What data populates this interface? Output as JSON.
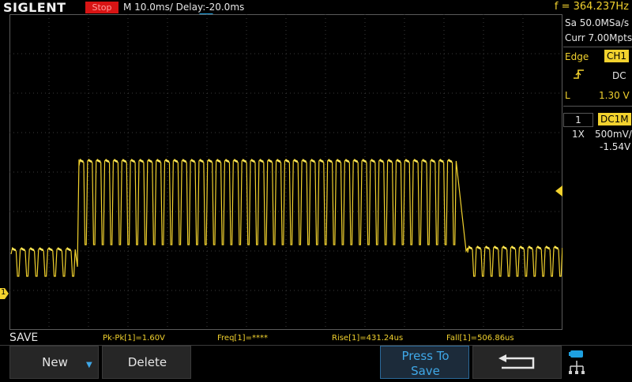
{
  "header": {
    "brand": "SIGLENT",
    "run_state": "Stop",
    "timebase": "M 10.0ms/ Delay:-20.0ms",
    "frequency": "f = 364.237Hz"
  },
  "acquisition": {
    "sample_rate": "Sa 50.0MSa/s",
    "memory_depth": "Curr 7.00Mpts"
  },
  "trigger": {
    "type_label": "Edge",
    "source": "CH1",
    "coupling": "DC",
    "level_label": "L",
    "level": "1.30 V"
  },
  "channel1": {
    "number": "1",
    "coupling": "DC1M",
    "probe": "1X",
    "scale": "500mV/",
    "offset": "-1.54V",
    "marker_label": "1"
  },
  "menu": {
    "title": "SAVE"
  },
  "measurements": [
    {
      "label": "Pk-Pk[1]=1.60V"
    },
    {
      "label": "Freq[1]=****"
    },
    {
      "label": "Rise[1]=431.24us"
    },
    {
      "label": "Fall[1]=506.86us"
    }
  ],
  "softkeys": {
    "new_label": "New",
    "delete_label": "Delete",
    "press_to_save_line1": "Press To",
    "press_to_save_line2": "Save"
  },
  "colors": {
    "trace": "#f2d22e",
    "accent_blue": "#1ea0e0",
    "stop_red": "#d81414",
    "grid": "#3c3c3c"
  },
  "icons": [
    "trigger-position-marker-icon",
    "rising-edge-icon",
    "trigger-level-marker-icon",
    "channel-ground-marker-icon",
    "down-arrow-icon",
    "return-arrow-icon",
    "network-usb-icon"
  ]
}
